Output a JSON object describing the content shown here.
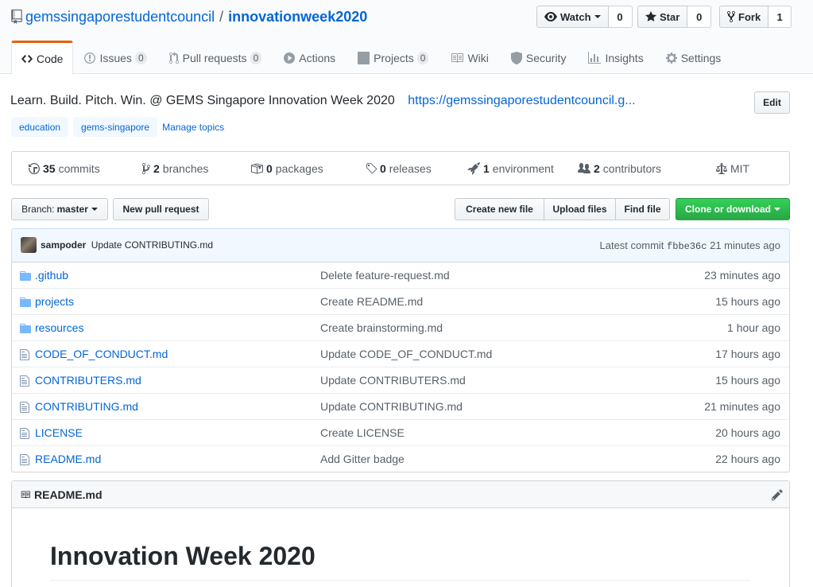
{
  "repo": {
    "owner": "gemssingaporestudentcouncil",
    "separator": "/",
    "name": "innovationweek2020"
  },
  "actions": {
    "watch": {
      "label": "Watch",
      "count": "0"
    },
    "star": {
      "label": "Star",
      "count": "0"
    },
    "fork": {
      "label": "Fork",
      "count": "1"
    }
  },
  "nav": {
    "code": "Code",
    "issues": {
      "label": "Issues",
      "count": "0"
    },
    "pulls": {
      "label": "Pull requests",
      "count": "0"
    },
    "actions": "Actions",
    "projects": {
      "label": "Projects",
      "count": "0"
    },
    "wiki": "Wiki",
    "security": "Security",
    "insights": "Insights",
    "settings": "Settings"
  },
  "about": {
    "description": "Learn. Build. Pitch. Win. @ GEMS Singapore Innovation Week 2020",
    "website": "https://gemssingaporestudentcouncil.g...",
    "edit_label": "Edit",
    "topics": [
      "education",
      "gems-singapore"
    ],
    "manage_topics": "Manage topics"
  },
  "summary": {
    "commits": {
      "count": "35",
      "label": "commits"
    },
    "branches": {
      "count": "2",
      "label": "branches"
    },
    "packages": {
      "count": "0",
      "label": "packages"
    },
    "releases": {
      "count": "0",
      "label": "releases"
    },
    "environment": {
      "count": "1",
      "label": "environment"
    },
    "contributors": {
      "count": "2",
      "label": "contributors"
    },
    "license": "MIT"
  },
  "filenav": {
    "branch_prefix": "Branch:",
    "branch_name": "master",
    "new_pr": "New pull request",
    "create_file": "Create new file",
    "upload_files": "Upload files",
    "find_file": "Find file",
    "clone": "Clone or download"
  },
  "latest_commit": {
    "author": "sampoder",
    "message": "Update CONTRIBUTING.md",
    "prefix": "Latest commit",
    "sha": "fbbe36c",
    "age": "21 minutes ago"
  },
  "files": [
    {
      "type": "dir",
      "name": ".github",
      "message": "Delete feature-request.md",
      "age": "23 minutes ago"
    },
    {
      "type": "dir",
      "name": "projects",
      "message": "Create README.md",
      "age": "15 hours ago"
    },
    {
      "type": "dir",
      "name": "resources",
      "message": "Create brainstorming.md",
      "age": "1 hour ago"
    },
    {
      "type": "file",
      "name": "CODE_OF_CONDUCT.md",
      "message": "Update CODE_OF_CONDUCT.md",
      "age": "17 hours ago"
    },
    {
      "type": "file",
      "name": "CONTRIBUTERS.md",
      "message": "Update CONTRIBUTERS.md",
      "age": "15 hours ago"
    },
    {
      "type": "file",
      "name": "CONTRIBUTING.md",
      "message": "Update CONTRIBUTING.md",
      "age": "21 minutes ago"
    },
    {
      "type": "file",
      "name": "LICENSE",
      "message": "Create LICENSE",
      "age": "20 hours ago"
    },
    {
      "type": "file",
      "name": "README.md",
      "message": "Add Gitter badge",
      "age": "22 hours ago"
    }
  ],
  "readme": {
    "filename": "README.md",
    "heading": "Innovation Week 2020"
  },
  "colors": {
    "link": "#0366d6",
    "nav_selected_accent": "#e36209",
    "clone_button": "#28a745",
    "commit_tease_bg": "#f1f8ff",
    "folder_icon": "#79b8ff"
  }
}
